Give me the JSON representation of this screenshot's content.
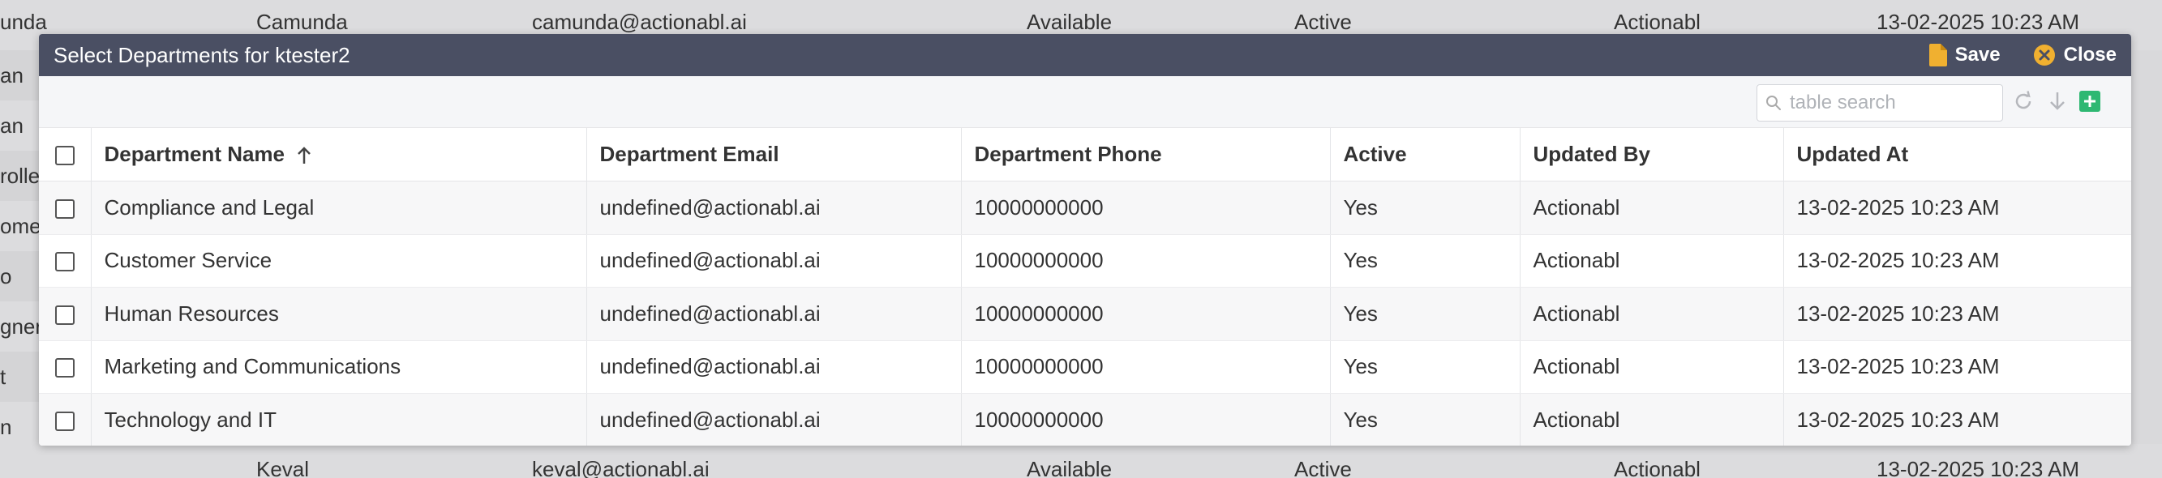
{
  "background": {
    "top_row": {
      "col1": "unda",
      "col2": "Camunda",
      "col3": "camunda@actionabl.ai",
      "col4": "Available",
      "col5": "Active",
      "col6": "Actionabl",
      "col7": "13-02-2025 10:23 AM"
    },
    "bottom_row": {
      "col2": "Keval",
      "col3": "keval@actionabl.ai",
      "col4": "Available",
      "col5": "Active",
      "col6": "Actionabl",
      "col7": "13-02-2025 10:23 AM"
    },
    "left_fragments": [
      "an",
      "an",
      "rolle",
      "omer",
      "o",
      "gner",
      "t",
      "n"
    ]
  },
  "dialog": {
    "title": "Select Departments for ktester2",
    "save_label": "Save",
    "close_label": "Close",
    "search_placeholder": "table search",
    "columns": [
      "Department Name",
      "Department Email",
      "Department Phone",
      "Active",
      "Updated By",
      "Updated At"
    ],
    "rows": [
      {
        "name": "Compliance and Legal",
        "email": "undefined@actionabl.ai",
        "phone": "10000000000",
        "active": "Yes",
        "updated_by": "Actionabl",
        "updated_at": "13-02-2025 10:23 AM"
      },
      {
        "name": "Customer Service",
        "email": "undefined@actionabl.ai",
        "phone": "10000000000",
        "active": "Yes",
        "updated_by": "Actionabl",
        "updated_at": "13-02-2025 10:23 AM"
      },
      {
        "name": "Human Resources",
        "email": "undefined@actionabl.ai",
        "phone": "10000000000",
        "active": "Yes",
        "updated_by": "Actionabl",
        "updated_at": "13-02-2025 10:23 AM"
      },
      {
        "name": "Marketing and Communications",
        "email": "undefined@actionabl.ai",
        "phone": "10000000000",
        "active": "Yes",
        "updated_by": "Actionabl",
        "updated_at": "13-02-2025 10:23 AM"
      },
      {
        "name": "Technology and IT",
        "email": "undefined@actionabl.ai",
        "phone": "10000000000",
        "active": "Yes",
        "updated_by": "Actionabl",
        "updated_at": "13-02-2025 10:23 AM"
      }
    ]
  },
  "colors": {
    "header_bg": "#4a4f63",
    "save_icon": "#f0b030",
    "close_icon": "#f0b030",
    "add_icon": "#2eb872"
  },
  "icons": {
    "save": "document-icon",
    "close": "close-circle-icon",
    "search": "search-icon",
    "refresh": "refresh-icon",
    "download": "arrow-down-icon",
    "add": "plus-square-icon",
    "sort": "arrow-up-icon"
  }
}
